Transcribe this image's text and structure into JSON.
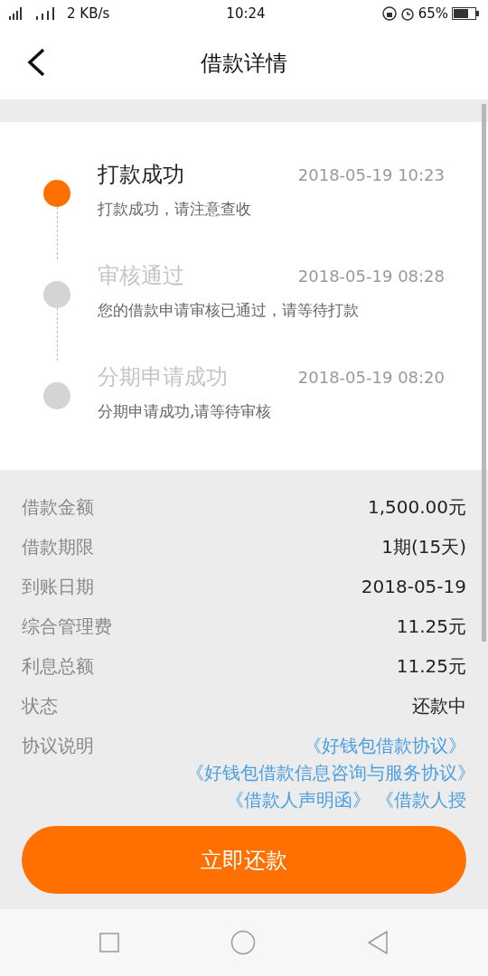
{
  "status_bar": {
    "network_speed": "2 KB/s",
    "time": "10:24",
    "battery": "65%"
  },
  "header": {
    "title": "借款详情"
  },
  "timeline": [
    {
      "title": "打款成功",
      "time": "2018-05-19 10:23",
      "description": "打款成功，请注意查收",
      "active": true
    },
    {
      "title": "审核通过",
      "time": "2018-05-19 08:28",
      "description": "您的借款申请审核已通过，请等待打款",
      "active": false
    },
    {
      "title": "分期申请成功",
      "time": "2018-05-19 08:20",
      "description": "分期申请成功,请等待审核",
      "active": false
    }
  ],
  "details": [
    {
      "label": "借款金额",
      "value": "1,500.00元"
    },
    {
      "label": "借款期限",
      "value": "1期(15天)"
    },
    {
      "label": "到账日期",
      "value": "2018-05-19"
    },
    {
      "label": "综合管理费",
      "value": "11.25元"
    },
    {
      "label": "利息总额",
      "value": "11.25元"
    },
    {
      "label": "状态",
      "value": "还款中"
    }
  ],
  "agreements": {
    "label": "协议说明",
    "links": [
      "《好钱包借款协议》",
      "《好钱包借款信息咨询与服务协议》",
      "《借款人声明函》",
      "《借款人授"
    ]
  },
  "repay_button": "立即还款"
}
